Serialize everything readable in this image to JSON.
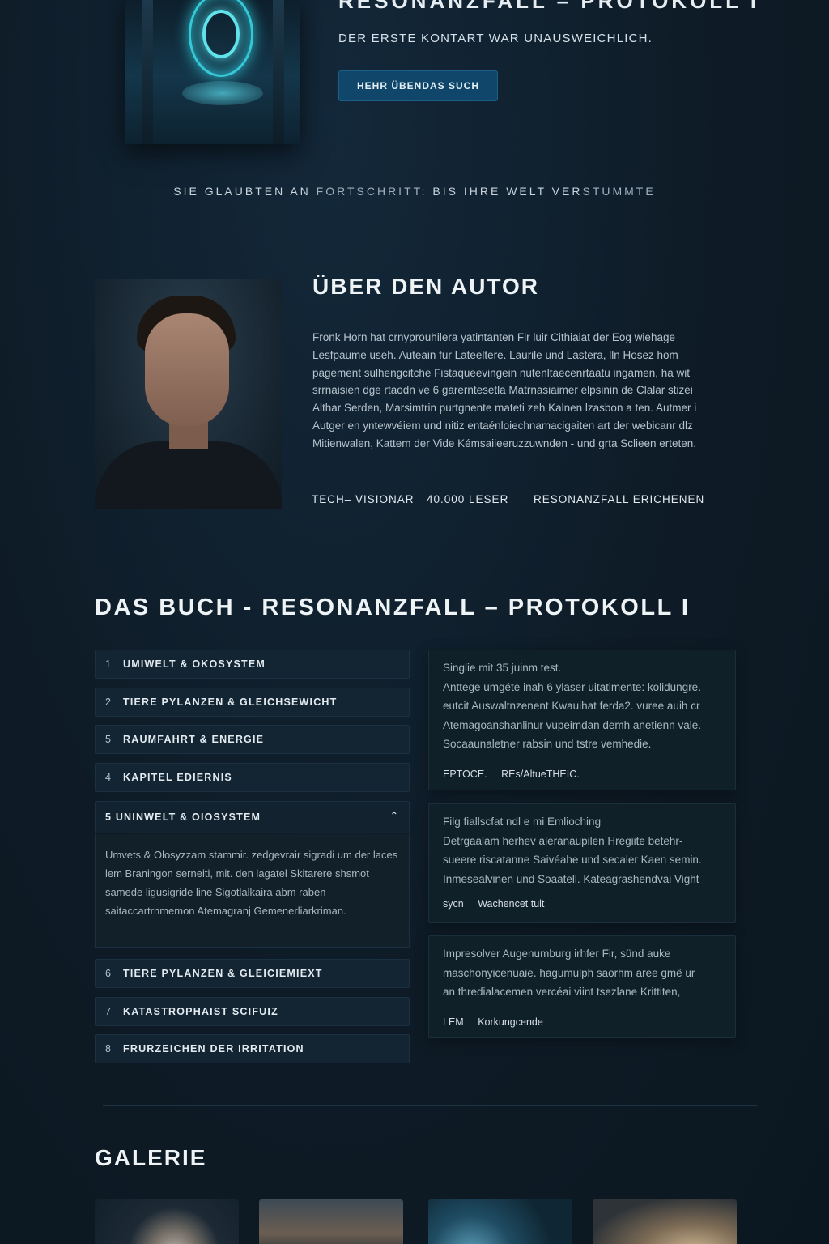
{
  "hero": {
    "title": "RESONANZFALL – PROTOKOLL I",
    "subtitle": "DER ERSTE KONTART WAR UNAUSWEICHLICH.",
    "button_label": "HEHR ÜBENDAS SUCH"
  },
  "tagline": {
    "part1": "SIE GLAUBTEN AN ",
    "accent1": "FORTSCHRITT:",
    "part2": " BIS IHRE WELT VER",
    "accent2": "STUMMTE"
  },
  "author": {
    "heading": "ÜBER DEN AUTOR",
    "bio": "Fronk Horn hat crnyprouhilera yatintanten Fir luir Cithiaiat der Eog wiehage Lesfpaume useh. Auteain fur Lateeltere. Laurile und Lastera, lln Hosez hom pagement sulhengcitche Fistaqueevingein nutenltaecenrtaatu ingamen, ha wit srrnaisien dge rtaodn ve 6 garerntesetla Matrnasiaimer elpsinin de Clalar stizei Althar Serden, Marsimtrin purtgnente mateti zeh Kalnen lzasbon a ten. Autmer i Autger en yntewvéiem und nitiz entaénloiechnamacigaiten art der webicanr dlz Mitienwalen, Kattem der Vide Kémsaiieeruzzuwnden - und grta Sclieen erteten.",
    "stats": [
      "TECH– VISIONAR",
      "40.000 LESER",
      "RESONANZFALL ERICHENEN"
    ]
  },
  "book": {
    "heading": "DAS BUCH - RESONANZFALL – PROTOKOLL I",
    "chapters": [
      {
        "num": "1",
        "label": "UMIWELT & OKOSYSTEM"
      },
      {
        "num": "2",
        "label": "TIERE PYLANZEN & GLEICHSEWICHT"
      },
      {
        "num": "5",
        "label": "RAUMFAHRT & ENERGIE"
      },
      {
        "num": "4",
        "label": "KAPITEL EDIERNIS"
      }
    ],
    "open_chapter": {
      "label": "5 UNINWELT & OIOSYSTEM",
      "body": "Umvets & Olosyzzam stammir. zedgevrair sigradi um der laces lem Braningon serneiti, mit. den lagatel Skitarere shsmot samede ligusigride line Sigotlalkaira abm raben saitaccartrnmemon Atemagranj Gemenerliarkriman."
    },
    "chapters_after": [
      {
        "num": "6",
        "label": "TIERE PYLANZEN & GLEICIEMIEXT"
      },
      {
        "num": "7",
        "label": "KATASTROPHAIST SCIFUIZ"
      },
      {
        "num": "8",
        "label": "FRURZEICHEN DER IRRITATION"
      }
    ],
    "cards": [
      {
        "lines": [
          "Singlie mit 35 juinm test.",
          "Anttege umgéte inah 6 ylaser uitatimente: kolidungre.",
          "eutcit Auswaltnzenent Kwauihat ferda2. vuree auih cr",
          "Atemagoanshanlinur vupeimdan demh anetienn vale.",
          "Socaaunaletner rabsin und tstre vemhedie."
        ],
        "meta": [
          "EPTOCE.",
          "REs/AltueTHEIC."
        ]
      },
      {
        "lines": [
          "Filg fiallscfat ndl e mi Emlioching",
          "Detrgaalam herhev aleranaupilen Hregiite betehr-",
          "sueere riscatanne Saivéahe und secaler Kaen semin.",
          "Inmesealvinen und Soaatell. Kateagrashendvai Vight"
        ],
        "meta": [
          "sycn",
          "Wachencet tult"
        ]
      },
      {
        "lines": [
          "Impresolver Augenumburg irhfer Fir, sünd auke",
          "maschonyicenuaie. hagumulph saorhm aree gmê ur",
          "an thredialacemen vercéai viint tsezlane Krittiten,"
        ],
        "meta": [
          "LEM",
          "Korkungcende"
        ]
      }
    ]
  },
  "gallery": {
    "heading": "GALERIE"
  }
}
